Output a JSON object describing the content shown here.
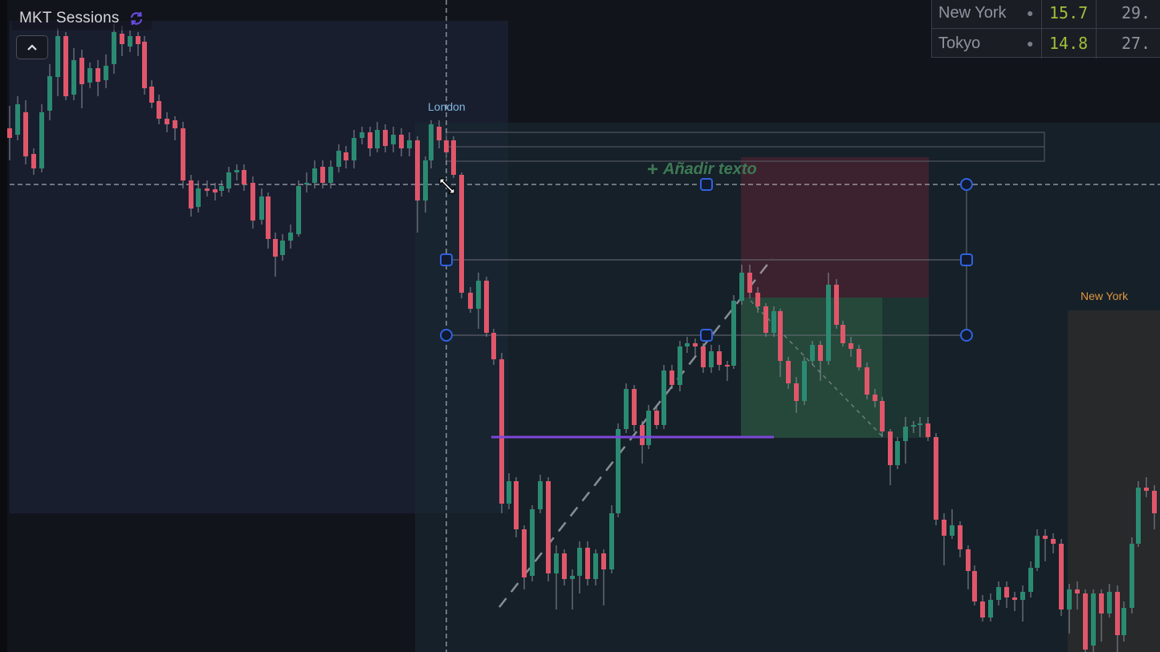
{
  "indicator": {
    "title": "MKT Sessions",
    "refresh_icon": "refresh-icon",
    "collapse_icon": "chevron-up-icon"
  },
  "sessions_table": [
    {
      "name": "New York",
      "status": "●",
      "value1": "15.7",
      "value2": "29."
    },
    {
      "name": "Tokyo",
      "status": "●",
      "value1": "14.8",
      "value2": "27."
    }
  ],
  "session_labels": {
    "london": "London",
    "new_york": "New York"
  },
  "drawing": {
    "add_text": "Añadir texto",
    "add_icon": "plus-icon"
  },
  "colors": {
    "bull": "#2b8a72",
    "bear": "#e0566a",
    "london_label": "#7fb8e0",
    "newyork_label": "#e0963f",
    "handle": "#2f63e0",
    "target_line": "#8a4fe0",
    "profit_zone": "#2d5a44",
    "loss_zone": "#5a2a36"
  },
  "chart_data": {
    "type": "candlestick",
    "title": "",
    "candles": [
      [
        12,
        160,
        172,
        132,
        200
      ],
      [
        22,
        168,
        130,
        120,
        175
      ],
      [
        32,
        140,
        195,
        125,
        205
      ],
      [
        42,
        192,
        210,
        185,
        218
      ],
      [
        52,
        210,
        140,
        130,
        215
      ],
      [
        62,
        138,
        95,
        80,
        150
      ],
      [
        72,
        96,
        45,
        35,
        120
      ],
      [
        82,
        45,
        120,
        40,
        125
      ],
      [
        92,
        118,
        75,
        60,
        125
      ],
      [
        102,
        72,
        105,
        62,
        135
      ],
      [
        112,
        103,
        85,
        78,
        110
      ],
      [
        122,
        85,
        102,
        75,
        120
      ],
      [
        132,
        100,
        82,
        68,
        110
      ],
      [
        142,
        80,
        40,
        30,
        92
      ],
      [
        152,
        42,
        55,
        32,
        70
      ],
      [
        162,
        58,
        45,
        38,
        65
      ],
      [
        172,
        45,
        55,
        40,
        70
      ],
      [
        180,
        52,
        110,
        45,
        118
      ],
      [
        189,
        108,
        128,
        100,
        135
      ],
      [
        198,
        126,
        148,
        118,
        155
      ],
      [
        208,
        148,
        155,
        140,
        165
      ],
      [
        218,
        150,
        160,
        145,
        175
      ],
      [
        228,
        160,
        225,
        152,
        235
      ],
      [
        238,
        225,
        260,
        218,
        270
      ],
      [
        247,
        258,
        235,
        225,
        265
      ],
      [
        258,
        235,
        238,
        225,
        245
      ],
      [
        268,
        236,
        240,
        228,
        250
      ],
      [
        276,
        238,
        232,
        225,
        245
      ],
      [
        285,
        235,
        215,
        208,
        240
      ],
      [
        295,
        215,
        212,
        205,
        225
      ],
      [
        304,
        212,
        230,
        205,
        238
      ],
      [
        315,
        228,
        275,
        220,
        285
      ],
      [
        326,
        274,
        245,
        235,
        280
      ],
      [
        334,
        245,
        298,
        240,
        310
      ],
      [
        343,
        298,
        320,
        290,
        345
      ],
      [
        352,
        318,
        300,
        292,
        325
      ],
      [
        362,
        300,
        290,
        280,
        310
      ],
      [
        372,
        292,
        232,
        225,
        295
      ],
      [
        382,
        230,
        228,
        215,
        240
      ],
      [
        392,
        228,
        210,
        200,
        235
      ],
      [
        402,
        208,
        228,
        200,
        235
      ],
      [
        412,
        228,
        208,
        200,
        235
      ],
      [
        422,
        208,
        188,
        180,
        215
      ],
      [
        431,
        190,
        200,
        182,
        210
      ],
      [
        441,
        200,
        172,
        162,
        210
      ],
      [
        451,
        172,
        165,
        158,
        180
      ],
      [
        461,
        165,
        185,
        158,
        195
      ],
      [
        470,
        185,
        162,
        152,
        190
      ],
      [
        480,
        162,
        182,
        155,
        190
      ],
      [
        490,
        180,
        168,
        158,
        190
      ],
      [
        500,
        168,
        185,
        160,
        195
      ],
      [
        510,
        185,
        175,
        165,
        195
      ],
      [
        520,
        175,
        250,
        170,
        290
      ],
      [
        530,
        250,
        200,
        195,
        265
      ],
      [
        537,
        200,
        155,
        150,
        210
      ],
      [
        547,
        158,
        175,
        150,
        185
      ],
      [
        556,
        175,
        190,
        170,
        195
      ],
      [
        565,
        175,
        218,
        170,
        222
      ],
      [
        575,
        218,
        365,
        215,
        372
      ],
      [
        586,
        365,
        385,
        358,
        390
      ],
      [
        596,
        385,
        350,
        340,
        410
      ],
      [
        606,
        350,
        415,
        345,
        420
      ],
      [
        615,
        415,
        448,
        410,
        455
      ],
      [
        625,
        448,
        628,
        440,
        640
      ],
      [
        634,
        628,
        600,
        590,
        635
      ],
      [
        643,
        600,
        660,
        595,
        670
      ],
      [
        653,
        660,
        720,
        655,
        735
      ],
      [
        663,
        718,
        635,
        630,
        725
      ],
      [
        673,
        635,
        600,
        592,
        640
      ],
      [
        683,
        600,
        715,
        595,
        725
      ],
      [
        693,
        715,
        690,
        680,
        760
      ],
      [
        703,
        690,
        722,
        685,
        730
      ],
      [
        713,
        722,
        718,
        710,
        760
      ],
      [
        722,
        718,
        683,
        675,
        740
      ],
      [
        732,
        683,
        722,
        675,
        730
      ],
      [
        742,
        722,
        690,
        685,
        730
      ],
      [
        752,
        690,
        710,
        685,
        755
      ],
      [
        762,
        710,
        640,
        630,
        715
      ],
      [
        770,
        640,
        535,
        528,
        645
      ],
      [
        780,
        535,
        485,
        478,
        540
      ],
      [
        790,
        485,
        530,
        480,
        538
      ],
      [
        800,
        530,
        555,
        525,
        578
      ],
      [
        808,
        555,
        512,
        505,
        560
      ],
      [
        818,
        512,
        530,
        505,
        535
      ],
      [
        827,
        530,
        462,
        455,
        535
      ],
      [
        837,
        462,
        480,
        455,
        485
      ],
      [
        847,
        480,
        432,
        425,
        488
      ],
      [
        856,
        432,
        428,
        420,
        440
      ],
      [
        866,
        428,
        432,
        422,
        445
      ],
      [
        876,
        432,
        458,
        428,
        465
      ],
      [
        886,
        458,
        438,
        430,
        465
      ],
      [
        896,
        438,
        455,
        430,
        462
      ],
      [
        906,
        455,
        456,
        450,
        475
      ],
      [
        914,
        456,
        375,
        368,
        460
      ],
      [
        924,
        375,
        340,
        330,
        380
      ],
      [
        934,
        340,
        365,
        330,
        372
      ],
      [
        944,
        365,
        382,
        358,
        390
      ],
      [
        954,
        382,
        415,
        378,
        420
      ],
      [
        964,
        415,
        388,
        382,
        420
      ],
      [
        972,
        388,
        450,
        385,
        470
      ],
      [
        982,
        450,
        478,
        445,
        485
      ],
      [
        992,
        478,
        500,
        470,
        515
      ],
      [
        1002,
        500,
        450,
        445,
        505
      ],
      [
        1012,
        450,
        430,
        425,
        455
      ],
      [
        1022,
        430,
        450,
        425,
        475
      ],
      [
        1032,
        450,
        355,
        340,
        455
      ],
      [
        1042,
        355,
        405,
        348,
        410
      ],
      [
        1050,
        405,
        428,
        400,
        432
      ],
      [
        1060,
        428,
        435,
        420,
        445
      ],
      [
        1070,
        435,
        458,
        430,
        462
      ],
      [
        1080,
        458,
        492,
        452,
        498
      ],
      [
        1090,
        492,
        500,
        485,
        508
      ],
      [
        1099,
        500,
        538,
        495,
        545
      ],
      [
        1109,
        538,
        580,
        535,
        605
      ],
      [
        1118,
        580,
        550,
        545,
        585
      ],
      [
        1128,
        550,
        532,
        520,
        578
      ],
      [
        1138,
        532,
        530,
        525,
        540
      ],
      [
        1146,
        530,
        528,
        520,
        545
      ],
      [
        1156,
        528,
        545,
        520,
        550
      ],
      [
        1166,
        545,
        648,
        540,
        655
      ],
      [
        1176,
        648,
        668,
        640,
        705
      ],
      [
        1186,
        668,
        655,
        635,
        672
      ],
      [
        1196,
        655,
        685,
        650,
        695
      ],
      [
        1206,
        685,
        712,
        680,
        735
      ],
      [
        1214,
        712,
        750,
        705,
        755
      ],
      [
        1224,
        750,
        770,
        742,
        775
      ],
      [
        1234,
        770,
        748,
        740,
        775
      ],
      [
        1244,
        748,
        732,
        725,
        755
      ],
      [
        1254,
        732,
        745,
        725,
        758
      ],
      [
        1264,
        745,
        748,
        738,
        762
      ],
      [
        1274,
        748,
        738,
        730,
        775
      ],
      [
        1284,
        738,
        708,
        700,
        745
      ],
      [
        1292,
        708,
        668,
        660,
        712
      ],
      [
        1302,
        668,
        672,
        660,
        700
      ],
      [
        1312,
        672,
        678,
        665,
        690
      ],
      [
        1322,
        678,
        760,
        672,
        768
      ],
      [
        1332,
        760,
        735,
        728,
        790
      ],
      [
        1342,
        735,
        740,
        725,
        760
      ],
      [
        1352,
        740,
        810,
        735,
        813
      ],
      [
        1362,
        805,
        740,
        735,
        813
      ],
      [
        1372,
        740,
        765,
        735,
        800
      ],
      [
        1382,
        765,
        738,
        728,
        770
      ],
      [
        1392,
        738,
        792,
        730,
        813
      ],
      [
        1400,
        792,
        758,
        750,
        800
      ],
      [
        1410,
        758,
        678,
        670,
        765
      ],
      [
        1418,
        678,
        608,
        600,
        682
      ],
      [
        1428,
        608,
        612,
        595,
        620
      ],
      [
        1438,
        612,
        640,
        605,
        660
      ]
    ],
    "levels": {
      "crosshair_price": 230
    },
    "sessions": [
      "London",
      "New York"
    ]
  }
}
